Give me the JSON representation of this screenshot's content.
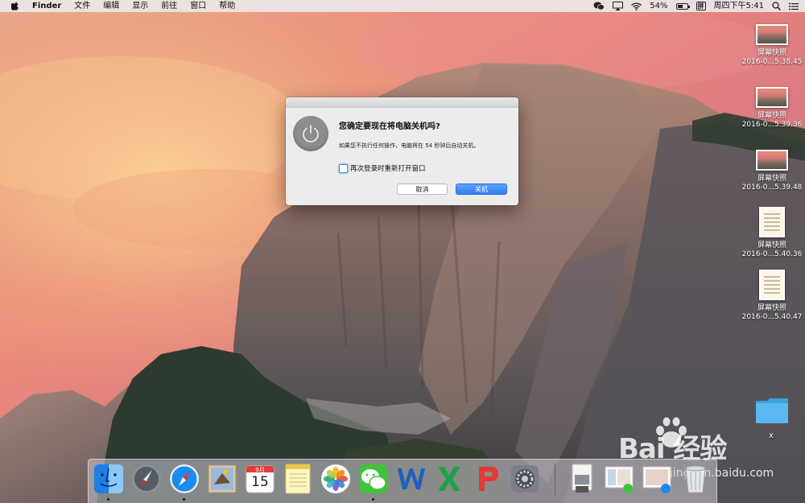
{
  "menubar": {
    "app_name": "Finder",
    "menus": [
      "文件",
      "编辑",
      "显示",
      "前往",
      "窗口",
      "帮助"
    ],
    "battery_percent": "54%",
    "battery_level": 0.54,
    "input_method": "拼",
    "clock": "周四下午5:41",
    "status_icons": [
      "wechat-icon",
      "airplay-icon",
      "wifi-icon",
      "battery-icon",
      "input-method-icon",
      "spotlight-icon",
      "notification-center-icon"
    ]
  },
  "desktop_icons": [
    {
      "name": "屏幕快照",
      "sub": "2016-0...5.38.45",
      "kind": "landscape"
    },
    {
      "name": "屏幕快照",
      "sub": "2016-0...5.39.36",
      "kind": "landscape"
    },
    {
      "name": "屏幕快照",
      "sub": "2016-0...5.39.48",
      "kind": "landscape"
    },
    {
      "name": "屏幕快照",
      "sub": "2016-0...5.40.36",
      "kind": "document"
    },
    {
      "name": "屏幕快照",
      "sub": "2016-0...5.40.47",
      "kind": "document"
    }
  ],
  "folder": {
    "label": "x"
  },
  "dialog": {
    "title": "您确定要现在将电脑关机吗?",
    "message": "如果您不执行任何操作，电脑将在 54 秒钟后自动关机。",
    "checkbox_label": "再次登录时重新打开窗口",
    "checkbox_checked": false,
    "cancel_label": "取消",
    "confirm_label": "关机"
  },
  "dock": {
    "apps": [
      "finder-icon",
      "launchpad-icon",
      "safari-icon",
      "mail-icon",
      "calendar-icon",
      "notes-icon",
      "photos-icon",
      "wechat-icon",
      "word-icon",
      "excel-icon",
      "powerpoint-icon",
      "system-preferences-icon",
      "preview-icon",
      "screenshot-stack-icon",
      "screenshot-stack-2-icon",
      "trash-icon"
    ],
    "calendar_month": "9月",
    "calendar_day": "15",
    "running_indicators": [
      "finder",
      "safari",
      "wechat"
    ]
  },
  "watermark": {
    "brand": "Bai  经验",
    "url": "jingyan.baidu.com"
  },
  "colors": {
    "accent": "#2f7ff0",
    "power_badge": "#8d8d8d",
    "menubar": "#ece6e8"
  }
}
